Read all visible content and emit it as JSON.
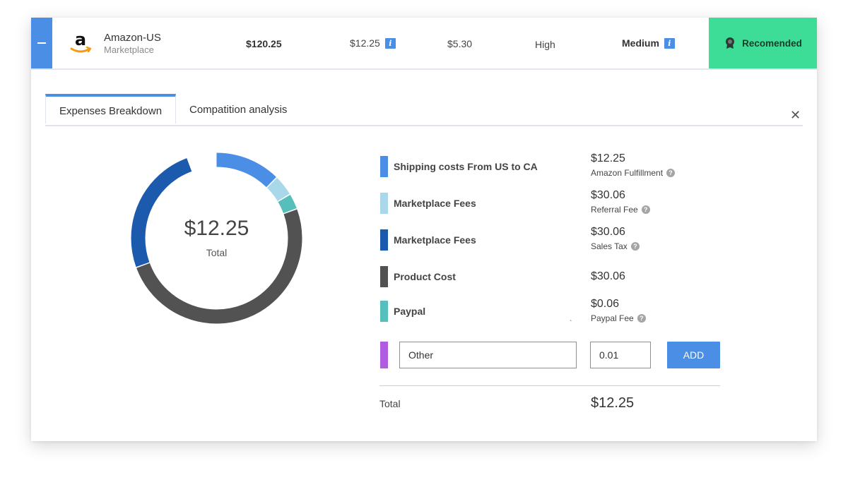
{
  "marketplace": {
    "name": "Amazon-US",
    "type": "Marketplace",
    "price": "$120.25",
    "fee": "$12.25",
    "shipping": "$5.30",
    "demand": "High",
    "competition": "Medium",
    "badge": "Recomended",
    "logo_icon": "amazon-logo",
    "badge_color": "#3ddc97"
  },
  "tabs": [
    {
      "label": "Expenses Breakdown",
      "active": true
    },
    {
      "label": "Compatition analysis",
      "active": false
    }
  ],
  "donut": {
    "total_amount": "$12.25",
    "total_label": "Total"
  },
  "expenses": [
    {
      "label": "Shipping costs From US to CA",
      "value": "$12.25",
      "sub": "Amazon Fulfillment",
      "color": "#4a8ee6",
      "share": 0.125
    },
    {
      "label": "Marketplace Fees",
      "value": "$30.06",
      "sub": "Referral Fee",
      "color": "#a8d8ea",
      "share": 0.04
    },
    {
      "label": "Marketplace Fees",
      "value": "$30.06",
      "sub": "Sales Tax",
      "color": "#1c5aad",
      "share": 0.25
    },
    {
      "label": "Product Cost",
      "value": "$30.06",
      "sub": "",
      "color": "#525252",
      "share": 0.5
    },
    {
      "label": "Paypal",
      "value": "$0.06",
      "sub": "Paypal Fee",
      "color": "#57bfbb",
      "share": 0.03
    }
  ],
  "other": {
    "name": "Other",
    "amount": "0.01",
    "add_label": "ADD",
    "color": "#b05be0"
  },
  "total": {
    "label": "Total",
    "value": "$12.25"
  }
}
